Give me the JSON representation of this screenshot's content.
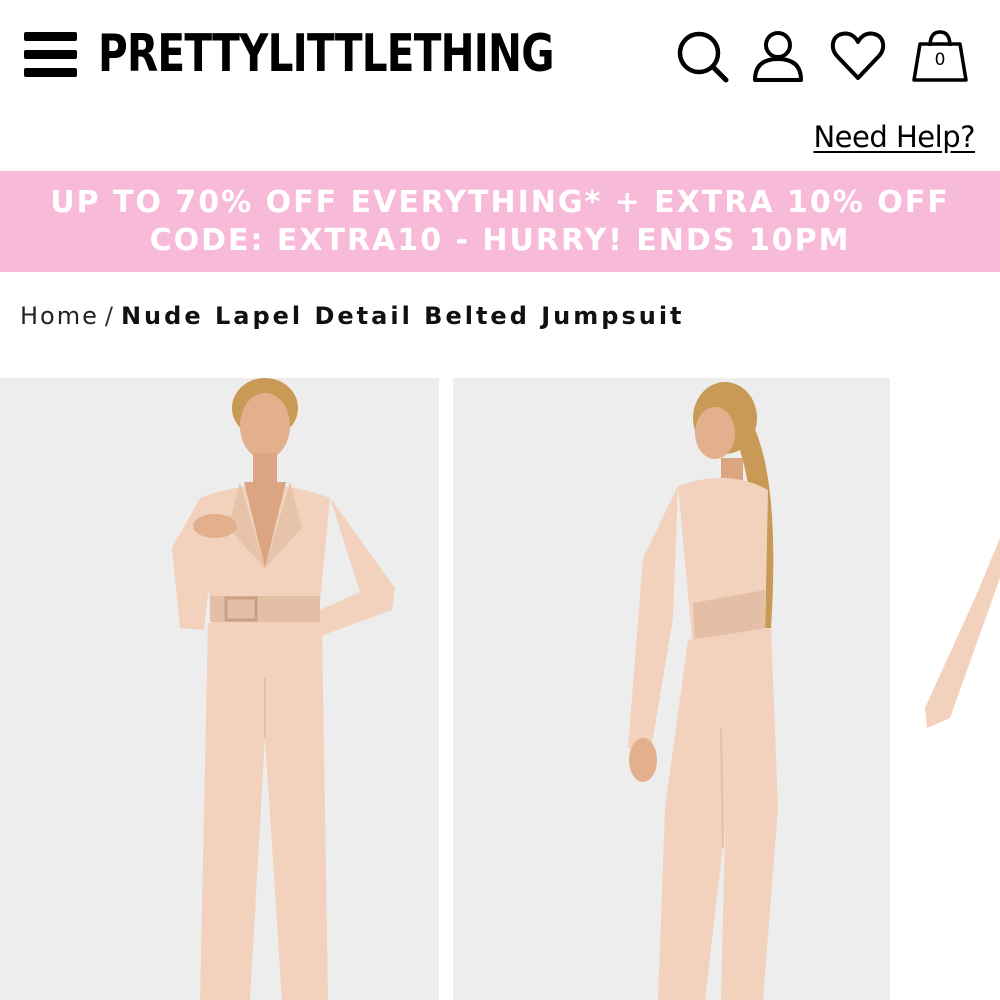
{
  "header": {
    "logo": "PRETTYLITTLETHING",
    "icons": [
      "menu-icon",
      "search-icon",
      "account-icon",
      "heart-icon",
      "bag-icon"
    ],
    "bag_count": "0",
    "need_help": "Need Help?"
  },
  "promo": {
    "text": "UP TO 70% OFF EVERYTHING* + EXTRA 10% OFF CODE: EXTRA10 - HURRY! ENDS 10PM",
    "background": "#f8bad9",
    "color": "#ffffff"
  },
  "breadcrumb": {
    "home": "Home",
    "separator": "/",
    "current": "Nude Lapel Detail Belted Jumpsuit"
  },
  "colors": {
    "jumpsuit": "#f2d2bc",
    "photo_background": "#ededed",
    "hair": "#c99a55"
  }
}
